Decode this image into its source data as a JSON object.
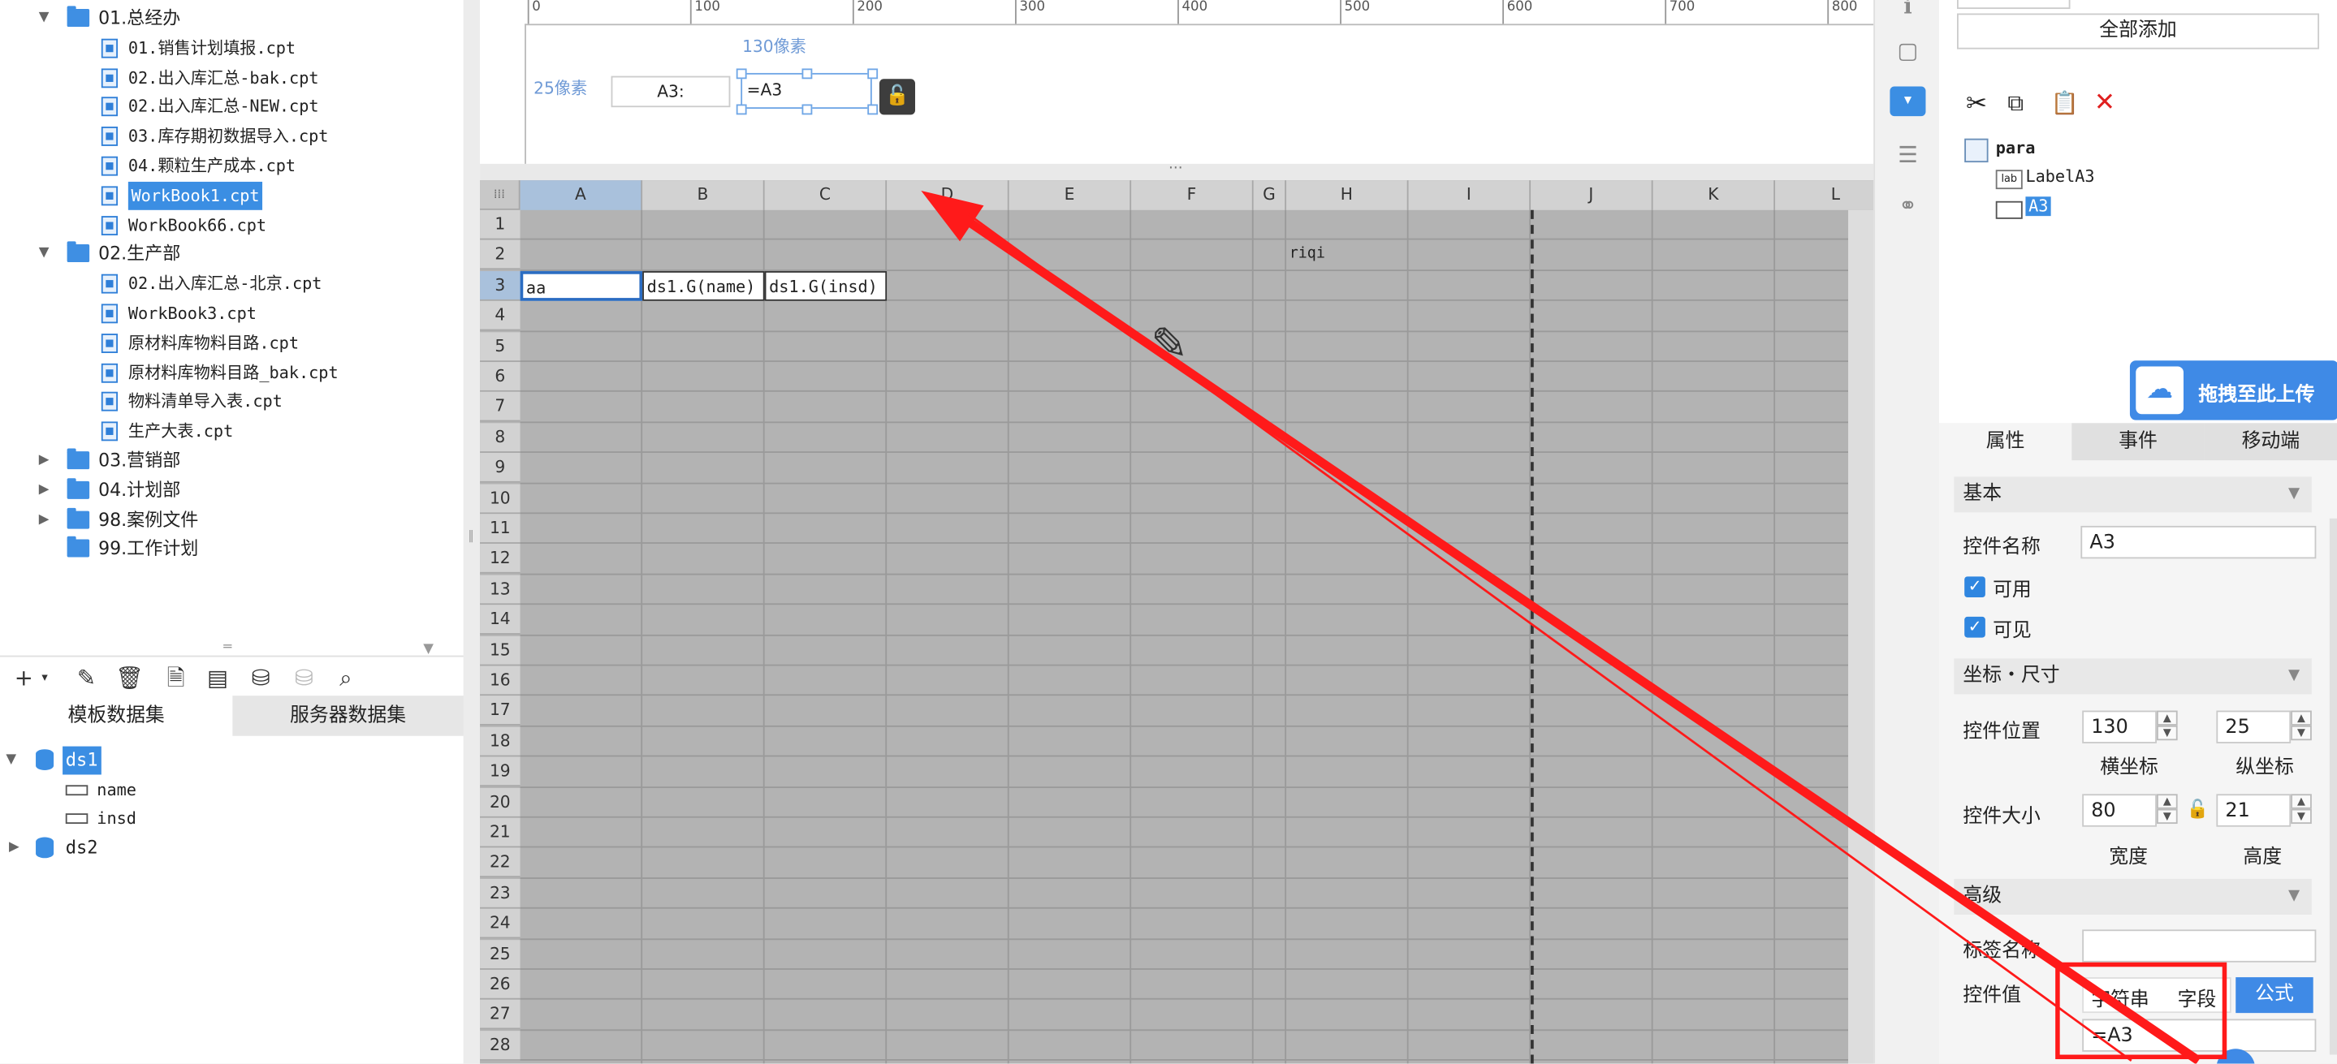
{
  "tree": {
    "items": [
      {
        "label": "01.总经办",
        "kind": "folder",
        "open": true,
        "indent": 0
      },
      {
        "label": "01.销售计划填报.cpt",
        "kind": "file",
        "indent": 1
      },
      {
        "label": "02.出入库汇总-bak.cpt",
        "kind": "file",
        "indent": 1
      },
      {
        "label": "02.出入库汇总-NEW.cpt",
        "kind": "file",
        "indent": 1
      },
      {
        "label": "03.库存期初数据导入.cpt",
        "kind": "file",
        "indent": 1
      },
      {
        "label": "04.颗粒生产成本.cpt",
        "kind": "file",
        "indent": 1
      },
      {
        "label": "WorkBook1.cpt",
        "kind": "file",
        "indent": 1,
        "selected": true
      },
      {
        "label": "WorkBook66.cpt",
        "kind": "file",
        "indent": 1
      },
      {
        "label": "02.生产部",
        "kind": "folder",
        "open": true,
        "indent": 0
      },
      {
        "label": "02.出入库汇总-北京.cpt",
        "kind": "file",
        "indent": 1
      },
      {
        "label": "WorkBook3.cpt",
        "kind": "file",
        "indent": 1
      },
      {
        "label": "原材料库物料目路.cpt",
        "kind": "file",
        "indent": 1
      },
      {
        "label": "原材料库物料目路_bak.cpt",
        "kind": "file",
        "indent": 1
      },
      {
        "label": "物料清单导入表.cpt",
        "kind": "file",
        "indent": 1
      },
      {
        "label": "生产大表.cpt",
        "kind": "file",
        "indent": 1
      },
      {
        "label": "03.营销部",
        "kind": "folder",
        "open": false,
        "indent": 0
      },
      {
        "label": "04.计划部",
        "kind": "folder",
        "open": false,
        "indent": 0
      },
      {
        "label": "98.案例文件",
        "kind": "folder",
        "open": false,
        "indent": 0
      },
      {
        "label": "99.工作计划",
        "kind": "folder",
        "open": null,
        "indent": 0
      }
    ]
  },
  "dataset_tabs": {
    "template": "模板数据集",
    "server": "服务器数据集"
  },
  "datasets": {
    "ds1": "ds1",
    "fields": [
      "name",
      "insd"
    ],
    "ds2": "ds2"
  },
  "param_pane": {
    "width_label": "130像素",
    "height_label": "25像素",
    "label_widget": "A3:",
    "text_widget": "=A3",
    "ruler_ticks": [
      "0",
      "100",
      "200",
      "300",
      "400",
      "500",
      "600",
      "700",
      "800"
    ]
  },
  "sheet": {
    "columns": [
      "A",
      "B",
      "C",
      "D",
      "E",
      "F",
      "G",
      "H",
      "I",
      "J",
      "K",
      "L"
    ],
    "rows": [
      "1",
      "2",
      "3",
      "4",
      "5",
      "6",
      "7",
      "8",
      "9",
      "10",
      "11",
      "12",
      "13",
      "14",
      "15",
      "16",
      "17",
      "18",
      "19",
      "20",
      "21",
      "22",
      "23",
      "24",
      "25",
      "26",
      "27",
      "28"
    ],
    "cells": {
      "H2": "riqi",
      "A3": "aa",
      "B3": "ds1.G(name)",
      "C3": "ds1.G(insd)"
    }
  },
  "right_panel": {
    "add_all_button": "全部添加",
    "widget_tree": {
      "root": "para",
      "label": "LabelA3",
      "widget": "A3"
    },
    "upload_badge": "拖拽至此上传",
    "tabs": [
      "属性",
      "事件",
      "移动端"
    ],
    "basic_section": "基本",
    "widget_name_label": "控件名称",
    "widget_name_value": "A3",
    "enabled_label": "可用",
    "visible_label": "可见",
    "coord_section": "坐标・尺寸",
    "position_label": "控件位置",
    "pos_x": "130",
    "pos_y": "25",
    "x_caption": "横坐标",
    "y_caption": "纵坐标",
    "size_label": "控件大小",
    "width_value": "80",
    "height_value": "21",
    "width_caption": "宽度",
    "height_caption": "高度",
    "advanced_section": "高级",
    "tag_name_label": "标签名称",
    "tag_name_value": "",
    "widget_value_label": "控件值",
    "value_types": [
      "字符串",
      "字段",
      "公式"
    ],
    "formula_value": "=A3"
  },
  "colors": {
    "accent": "#3b8ee3",
    "annotation": "#ff1a1a"
  }
}
